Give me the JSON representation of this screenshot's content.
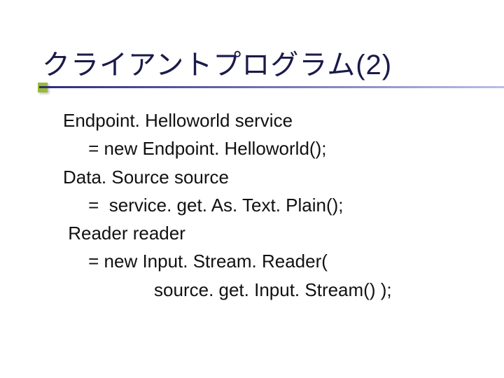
{
  "title": "クライアントプログラム(2)",
  "code": {
    "l1": "Endpoint. Helloworld service",
    "l2": "     = new Endpoint. Helloworld();",
    "l3": "Data. Source source",
    "l4": "     =  service. get. As. Text. Plain();",
    "l5": " Reader reader",
    "l6": "     = new Input. Stream. Reader(",
    "l7": "                  source. get. Input. Stream() );"
  }
}
